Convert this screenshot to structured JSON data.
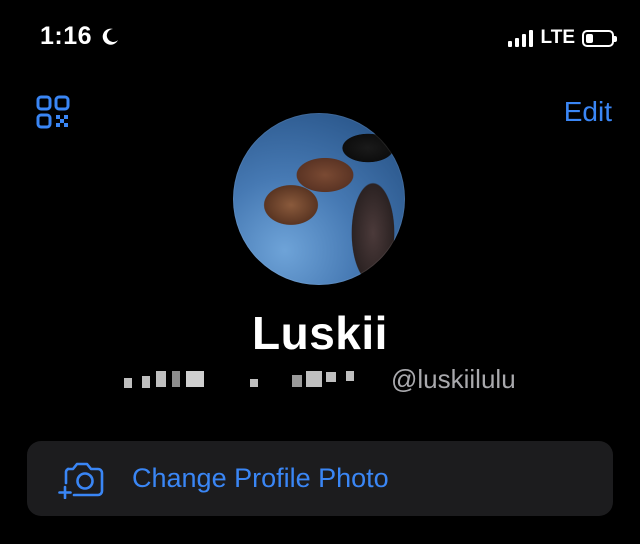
{
  "status_bar": {
    "time": "1:16",
    "network": "LTE",
    "battery_level": 0.28
  },
  "nav": {
    "edit_label": "Edit"
  },
  "profile": {
    "display_name": "Luskii",
    "username": "@luskiilulu",
    "change_photo_label": "Change Profile Photo"
  },
  "colors": {
    "accent": "#3a86f5",
    "background": "#000000",
    "row_background": "#1c1c1e",
    "secondary_text": "#a9a9ad"
  },
  "icons": {
    "qr": "qr-code-icon",
    "camera": "camera-add-icon",
    "moon": "moon-icon"
  }
}
